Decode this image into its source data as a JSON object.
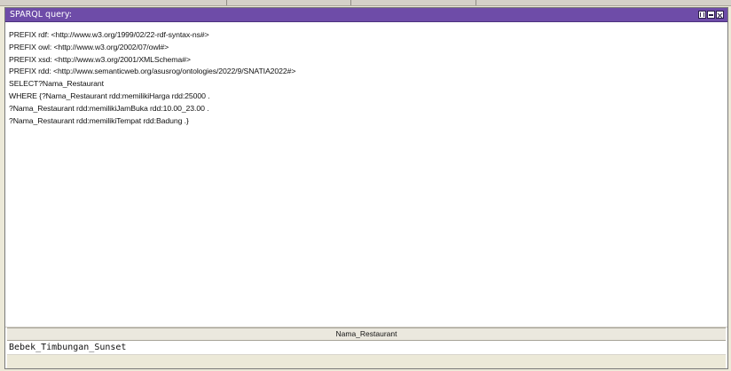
{
  "panel": {
    "title": "SPARQL query:",
    "accent_color": "#6e4ca8",
    "controls": [
      {
        "name": "restore-icon"
      },
      {
        "name": "minimize-icon"
      },
      {
        "name": "close-icon"
      }
    ]
  },
  "query": {
    "lines": [
      "PREFIX rdf: <http://www.w3.org/1999/02/22-rdf-syntax-ns#>",
      "PREFIX owl: <http://www.w3.org/2002/07/owl#>",
      "PREFIX xsd: <http://www.w3.org/2001/XMLSchema#>",
      "PREFIX rdd: <http://www.semanticweb.org/asusrog/ontologies/2022/9/SNATIA2022#>",
      "SELECT?Nama_Restaurant",
      "WHERE {?Nama_Restaurant rdd:memilikiHarga rdd:25000 .",
      "?Nama_Restaurant rdd:memilikiJamBuka rdd:10.00_23.00 .",
      "?Nama_Restaurant rdd:memilikiTempat rdd:Badung .}"
    ]
  },
  "results": {
    "columns": [
      "Nama_Restaurant"
    ],
    "rows": [
      [
        "Bebek_Timbungan_Sunset"
      ]
    ]
  }
}
